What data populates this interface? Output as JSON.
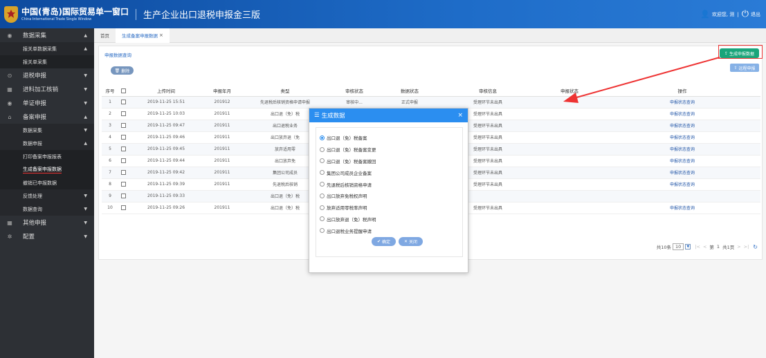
{
  "header": {
    "brand_cn": "中国(青岛)国际贸易单一窗口",
    "brand_en": "China International Trade Single Window",
    "separator": "|",
    "app_title": "生产企业出口退税申报金三版",
    "welcome": "欢迎您, 测",
    "logout": "退出"
  },
  "sidebar": {
    "items": [
      {
        "label": "数据采集",
        "level": 1,
        "icon": "database-icon",
        "arrow": "▲"
      },
      {
        "label": "报关单数据采集",
        "level": 2,
        "arrow": "▲"
      },
      {
        "label": "报关单采集",
        "level": 3,
        "arrow": ""
      },
      {
        "label": "退税申报",
        "level": 1,
        "icon": "refund-icon",
        "arrow": "▼"
      },
      {
        "label": "进料加工核销",
        "level": 1,
        "icon": "processing-icon",
        "arrow": "▼"
      },
      {
        "label": "单证申报",
        "level": 1,
        "icon": "document-icon",
        "arrow": "▼"
      },
      {
        "label": "备案申报",
        "level": 1,
        "icon": "filing-icon",
        "arrow": "▲"
      },
      {
        "label": "数据采集",
        "level": 2,
        "arrow": "▼"
      },
      {
        "label": "数据申报",
        "level": 2,
        "arrow": "▲"
      },
      {
        "label": "打印备案申报报表",
        "level": 3,
        "arrow": ""
      },
      {
        "label": "生成备案申报数据",
        "level": 3,
        "arrow": "",
        "active": true
      },
      {
        "label": "撤销已申报数据",
        "level": 3,
        "arrow": ""
      },
      {
        "label": "反馈处理",
        "level": 2,
        "arrow": "▼"
      },
      {
        "label": "数据查询",
        "level": 2,
        "arrow": "▼"
      },
      {
        "label": "其他申报",
        "level": 1,
        "icon": "other-icon",
        "arrow": "▼"
      },
      {
        "label": "配置",
        "level": 1,
        "icon": "gear-icon",
        "arrow": "▼"
      }
    ]
  },
  "tabs": {
    "home": "首页",
    "current": "生成备案申报数据",
    "close": "×"
  },
  "panel": {
    "breadcrumb": "申报数据查询",
    "delete_label": "删除",
    "generate_label": "生成申报数据",
    "remote_label": "远程申报"
  },
  "table": {
    "columns": [
      "序号",
      "",
      "上传时间",
      "申报年月",
      "类型",
      "审核状态",
      "数据状态",
      "审核信息",
      "申报状态",
      "操作"
    ],
    "rows": [
      [
        "1",
        "2019-11-25 15:51",
        "201912",
        "先退税后核销资格申请申报",
        "审核中...",
        "正式申报",
        "受理环节未出具",
        "",
        "申报状态查询"
      ],
      [
        "2",
        "2019-11-25 10:03",
        "201911",
        "出口退（免）税",
        "",
        "",
        "受理环节未出具",
        "",
        "申报状态查询"
      ],
      [
        "3",
        "2019-11-25 09:47",
        "201911",
        "出口退税业务",
        "",
        "",
        "受理环节未出具",
        "",
        "申报状态查询"
      ],
      [
        "4",
        "2019-11-25 09:46",
        "201911",
        "出口放弃退（免",
        "",
        "",
        "受理环节未出具",
        "",
        "申报状态查询"
      ],
      [
        "5",
        "2019-11-25 09:45",
        "201911",
        "放弃适用零",
        "",
        "",
        "受理环节未出具",
        "",
        "申报状态查询"
      ],
      [
        "6",
        "2019-11-25 09:44",
        "201911",
        "出口放弃免",
        "",
        "",
        "受理环节未出具",
        "",
        "申报状态查询"
      ],
      [
        "7",
        "2019-11-25 09:42",
        "201911",
        "集团公司成员",
        "",
        "",
        "受理环节未出具",
        "",
        "申报状态查询"
      ],
      [
        "8",
        "2019-11-25 09:39",
        "201911",
        "先退税后核销",
        "",
        "",
        "受理环节未出具",
        "",
        "申报状态查询"
      ],
      [
        "9",
        "2019-11-25 09:33",
        "",
        "出口退（免）税",
        "",
        "",
        "",
        "",
        ""
      ],
      [
        "10",
        "2019-11-25 09:26",
        "201911",
        "出口退（免）税",
        "",
        "",
        "受理环节未出具",
        "",
        "申报状态查询"
      ]
    ]
  },
  "pager": {
    "total": "共10条",
    "page_size": "10",
    "first": "|<",
    "prev": "<",
    "page_prefix": "第",
    "page_num": "1",
    "of": "共1页",
    "next": ">",
    "last": ">|",
    "refresh": "↻"
  },
  "modal": {
    "title": "生成数据",
    "close": "×",
    "options": [
      "出口退（免）税备案",
      "出口退（免）税备案变更",
      "出口退（免）税备案撤回",
      "集团公司成员企业备案",
      "先退税后核销资格申请",
      "出口放弃免税权声明",
      "放弃适用零税率声明",
      "出口放弃退（免）税声明",
      "出口退税业务提醒申请"
    ],
    "selected_index": 0,
    "confirm": "确定",
    "cancel": "关闭"
  }
}
